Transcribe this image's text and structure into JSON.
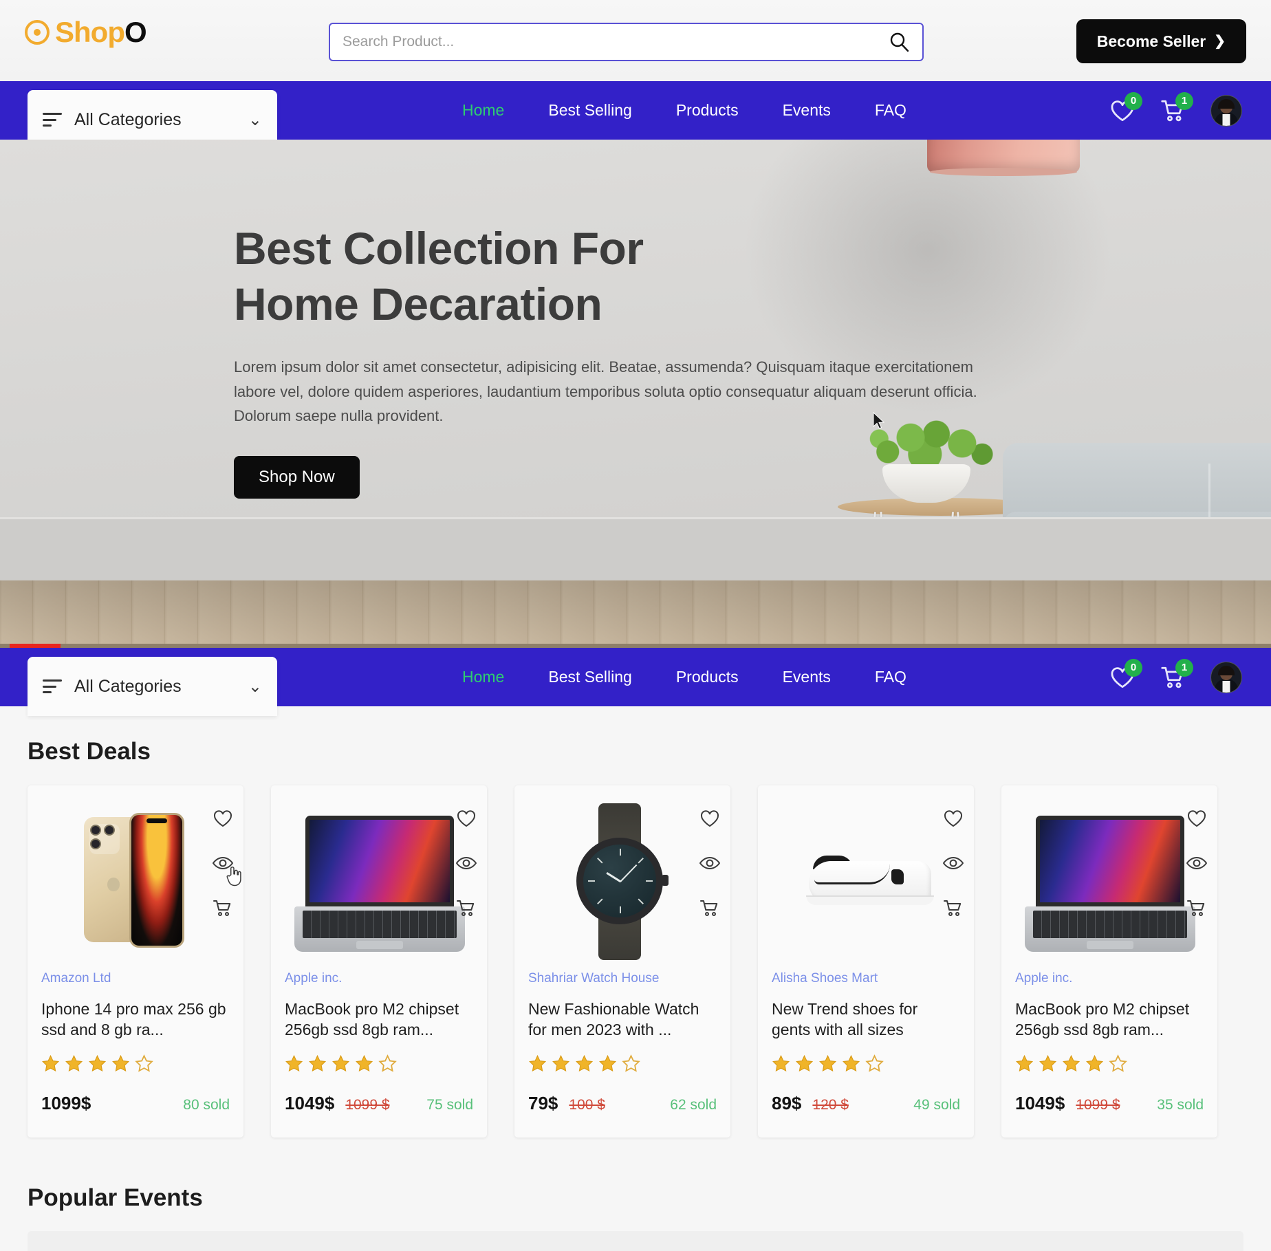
{
  "header": {
    "logo_text": "Shop",
    "logo_tail": "O",
    "logo_icon": "target-icon",
    "search": {
      "value": "",
      "placeholder": "Search Product...",
      "icon": "search-icon"
    },
    "become_seller": {
      "label": "Become Seller",
      "icon": "chevron-right-icon"
    }
  },
  "nav": {
    "categories_label": "All Categories",
    "categories_icon": "filter-lines-icon",
    "chevron": "⌄",
    "links": [
      {
        "label": "Home",
        "active": true
      },
      {
        "label": "Best Selling",
        "active": false
      },
      {
        "label": "Products",
        "active": false
      },
      {
        "label": "Events",
        "active": false
      },
      {
        "label": "FAQ",
        "active": false
      }
    ],
    "wishlist": {
      "icon": "heart-icon",
      "count": "0"
    },
    "cart": {
      "icon": "cart-icon",
      "count": "1"
    },
    "profile": {
      "icon": "avatar"
    },
    "accent_color": "#3321c8",
    "active_link_color": "#2ecc71",
    "badge_color": "#22b04b"
  },
  "hero": {
    "heading_line1": "Best Collection For",
    "heading_line2": "Home Decaration",
    "paragraph": "Lorem ipsum dolor sit amet consectetur, adipisicing elit. Beatae, assumenda? Quisquam itaque exercitationem labore vel, dolore quidem asperiores, laudantium temporibus soluta optio consequatur aliquam deserunt officia. Dolorum saepe nulla provident.",
    "cta_label": "Shop Now"
  },
  "best_deals": {
    "title": "Best Deals",
    "card_icons": {
      "wishlist": "heart-icon",
      "quickview": "eye-icon",
      "addcart": "cart-icon"
    },
    "products": [
      {
        "shop": "Amazon Ltd",
        "name": "Iphone 14 pro max 256 gb ssd and 8 gb ra...",
        "rating": 4,
        "max_rating": 5,
        "price": "1099$",
        "old_price": "",
        "sold": "80 sold",
        "art": "iphone"
      },
      {
        "shop": "Apple inc.",
        "name": "MacBook pro M2 chipset 256gb ssd 8gb ram...",
        "rating": 4,
        "max_rating": 5,
        "price": "1049$",
        "old_price": "1099 $",
        "sold": "75 sold",
        "art": "macbook"
      },
      {
        "shop": "Shahriar Watch House",
        "name": "New Fashionable Watch for men 2023 with ...",
        "rating": 4,
        "max_rating": 5,
        "price": "79$",
        "old_price": "100 $",
        "sold": "62 sold",
        "art": "watch"
      },
      {
        "shop": "Alisha Shoes Mart",
        "name": "New Trend shoes for gents with all sizes",
        "rating": 4,
        "max_rating": 5,
        "price": "89$",
        "old_price": "120 $",
        "sold": "49 sold",
        "art": "shoe"
      },
      {
        "shop": "Apple inc.",
        "name": "MacBook pro M2 chipset 256gb ssd 8gb ram...",
        "rating": 4,
        "max_rating": 5,
        "price": "1049$",
        "old_price": "1099 $",
        "sold": "35 sold",
        "art": "macbook"
      }
    ]
  },
  "popular_events": {
    "title": "Popular Events"
  },
  "colors": {
    "brand_orange": "#f2ab2e",
    "nav_blue": "#3321c8",
    "green": "#2ecc71",
    "sold_green": "#58c07a",
    "old_price_red": "#d04a3b",
    "shop_link_blue": "#7b8fe8",
    "star_gold": "#f0b429"
  }
}
